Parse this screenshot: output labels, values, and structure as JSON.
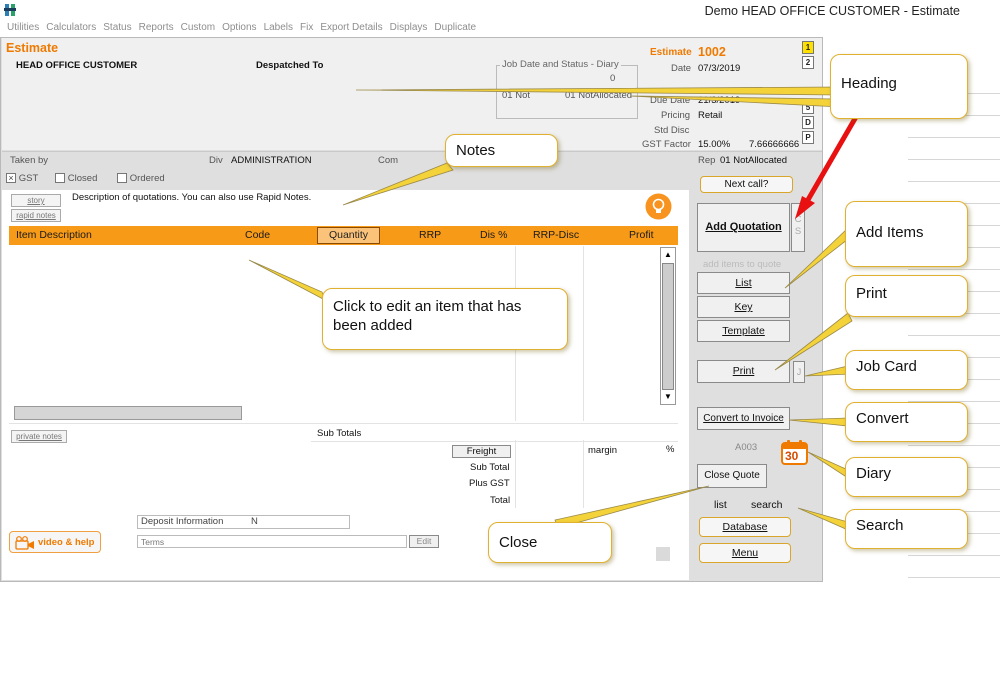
{
  "window": {
    "title": "Demo HEAD OFFICE CUSTOMER - Estimate"
  },
  "menu": [
    "Utilities",
    "Calculators",
    "Status",
    "Reports",
    "Custom",
    "Options",
    "Labels",
    "Fix",
    "Export Details",
    "Displays",
    "Duplicate"
  ],
  "header": {
    "doc_type": "Estimate",
    "customer": "HEAD OFFICE CUSTOMER",
    "despatched_to": "Despatched To",
    "job_box_title": "Job Date and Status - Diary",
    "job_value": "0",
    "job_status_left": "01 Not",
    "job_status_right": "01 NotAllocated",
    "estimate_label": "Estimate",
    "estimate_number": "1002",
    "date_label": "Date",
    "date_value": "07/3/2019",
    "due_label": "Due Date",
    "due_value": "21/3/2019",
    "pricing_label": "Pricing",
    "pricing_value": "Retail",
    "std_disc_label": "Std Disc",
    "gst_factor_label": "GST Factor",
    "gst_factor_value": "15.00%",
    "gst_factor_value2": "7.66666666",
    "side_buttons": [
      "1",
      "2",
      "5",
      "D",
      "P"
    ]
  },
  "row_taken": {
    "taken_by_label": "Taken by",
    "div_label": "Div",
    "div_value": "ADMINISTRATION",
    "com_label": "Com",
    "rep_label": "Rep",
    "rep_value": "01 NotAllocated"
  },
  "flags": {
    "gst": "GST",
    "closed": "Closed",
    "ordered": "Ordered"
  },
  "notes": {
    "story_btn": "story",
    "rapid_btn": "rapid notes",
    "text": "Description of quotations. You can also use Rapid Notes."
  },
  "grid": {
    "columns": [
      "Item Description",
      "Code",
      "Quantity",
      "RRP",
      "Dis %",
      "RRP-Disc",
      "Profit"
    ]
  },
  "totals": {
    "private_notes": "private notes",
    "sub_totals": "Sub Totals",
    "freight": "Freight",
    "margin": "margin",
    "percent": "%",
    "sub_total": "Sub Total",
    "plus_gst": "Plus GST",
    "total": "Total"
  },
  "deposit": {
    "label": "Deposit Information",
    "value": "N",
    "terms_placeholder": "Terms",
    "edit_btn": "Edit"
  },
  "video_help": "video & help",
  "side": {
    "next_call": "Next call?",
    "add_quotation": "Add Quotation",
    "cs": [
      "C",
      "S"
    ],
    "add_items_hint": "add items to quote",
    "list": "List",
    "key": "Key",
    "template": "Template",
    "print": "Print",
    "print_j": "J",
    "convert": "Convert to Invoice",
    "code": "A003",
    "calendar_day": "30",
    "close_quote": "Close Quote",
    "list_link": "list",
    "search_link": "search",
    "database": "Database",
    "menu": "Menu"
  },
  "callouts": {
    "heading": "Heading",
    "notes": "Notes",
    "add_items": "Add Items",
    "print": "Print",
    "job_card": "Job Card",
    "convert": "Convert",
    "diary": "Diary",
    "search": "Search",
    "close": "Close",
    "edit_item": "Click to edit an item that has been added"
  },
  "colors": {
    "accent": "#f79a17",
    "estimate_orange": "#f07a00",
    "callout_border": "#e0b030",
    "arrow_red": "#e81010"
  }
}
